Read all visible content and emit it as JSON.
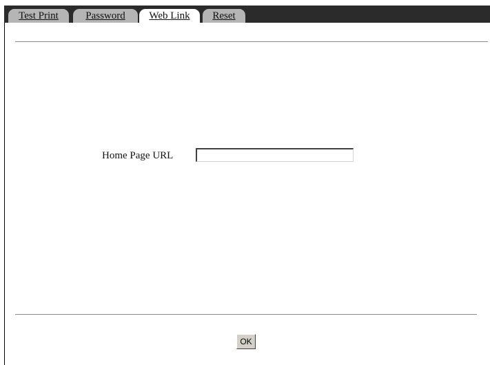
{
  "tabs": [
    {
      "label": "Test Print",
      "active": false
    },
    {
      "label": "Password",
      "active": false
    },
    {
      "label": "Web Link",
      "active": true
    },
    {
      "label": "Reset",
      "active": false
    }
  ],
  "form": {
    "home_page_url_label": "Home Page URL",
    "home_page_url_value": ""
  },
  "actions": {
    "ok_label": "OK"
  },
  "colors": {
    "tab_strip": "#2b2b2b",
    "tab_inactive": "#b5b5b5",
    "tab_active": "#ffffff",
    "divider": "#8a8a8a",
    "button_face": "#d4d0c8"
  }
}
